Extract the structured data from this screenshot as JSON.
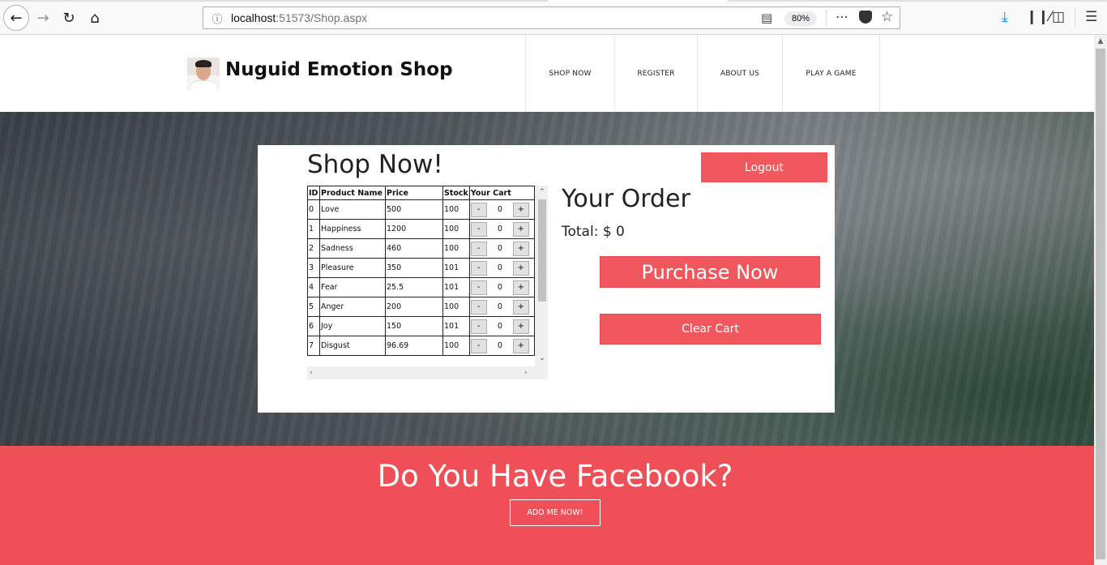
{
  "browser": {
    "url_host": "localhost",
    "url_path": ":51573/Shop.aspx",
    "zoom": "80%",
    "icons": [
      "back-icon",
      "forward-icon",
      "reload-icon",
      "home-icon",
      "info-icon",
      "reader-icon",
      "more-icon",
      "pocket-icon",
      "star-icon",
      "download-icon",
      "library-icon",
      "sidebar-icon",
      "menu-icon"
    ]
  },
  "header": {
    "brand": "Nuguid Emotion Shop",
    "nav": [
      "SHOP NOW",
      "REGISTER",
      "ABOUT US",
      "PLAY A GAME"
    ]
  },
  "shop": {
    "title": "Shop Now!",
    "logout_label": "Logout",
    "columns": [
      "ID",
      "Product Name",
      "Price",
      "Stock",
      "Your Cart"
    ],
    "rows": [
      {
        "id": "0",
        "name": "Love",
        "price": "500",
        "stock": "100",
        "qty": "0"
      },
      {
        "id": "1",
        "name": "Happiness",
        "price": "1200",
        "stock": "100",
        "qty": "0"
      },
      {
        "id": "2",
        "name": "Sadness",
        "price": "460",
        "stock": "100",
        "qty": "0"
      },
      {
        "id": "3",
        "name": "Pleasure",
        "price": "350",
        "stock": "101",
        "qty": "0"
      },
      {
        "id": "4",
        "name": "Fear",
        "price": "25.5",
        "stock": "101",
        "qty": "0"
      },
      {
        "id": "5",
        "name": "Anger",
        "price": "200",
        "stock": "100",
        "qty": "0"
      },
      {
        "id": "6",
        "name": "Joy",
        "price": "150",
        "stock": "101",
        "qty": "0"
      },
      {
        "id": "7",
        "name": "Disgust",
        "price": "96.69",
        "stock": "100",
        "qty": "0"
      }
    ],
    "minus_label": "-",
    "plus_label": "+"
  },
  "order": {
    "title": "Your Order",
    "total": "Total: $ 0",
    "purchase_label": "Purchase Now",
    "clear_label": "Clear Cart"
  },
  "facebook": {
    "title": "Do You Have Facebook?",
    "button_label": "ADD ME NOW!"
  },
  "colors": {
    "accent": "#f1585e",
    "band": "#ef5057"
  }
}
